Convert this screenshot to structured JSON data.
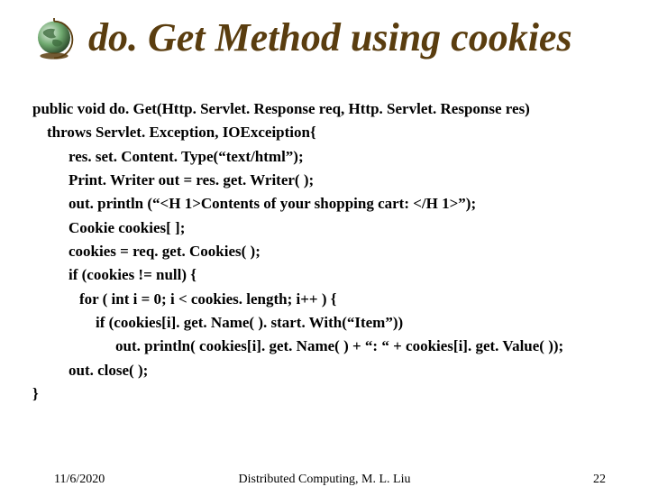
{
  "title": "do. Get Method using cookies",
  "code": {
    "line1": "public void do. Get(Http. Servlet. Response req, Http. Servlet. Response res)",
    "line2": "throws Servlet. Exception, IOExceiption{",
    "line3": "res. set. Content. Type(“text/html”);",
    "line4": "Print. Writer out = res. get. Writer( );",
    "line5": "out. println (“<H 1>Contents of your shopping cart: </H 1>”);",
    "line6": "Cookie cookies[ ];",
    "line7": "cookies = req. get. Cookies( );",
    "line8": "if (cookies != null) {",
    "line9": "for ( int i = 0; i < cookies. length; i++ ) {",
    "line10": "if (cookies[i]. get. Name( ). start. With(“Item”))",
    "line11": "out. println( cookies[i]. get. Name( ) + “: “ + cookies[i]. get. Value( ));",
    "line12": "out. close( );",
    "line13": "}"
  },
  "footer": {
    "date": "11/6/2020",
    "center": "Distributed Computing, M. L. Liu",
    "page": "22"
  },
  "globe_alt": "globe-icon"
}
